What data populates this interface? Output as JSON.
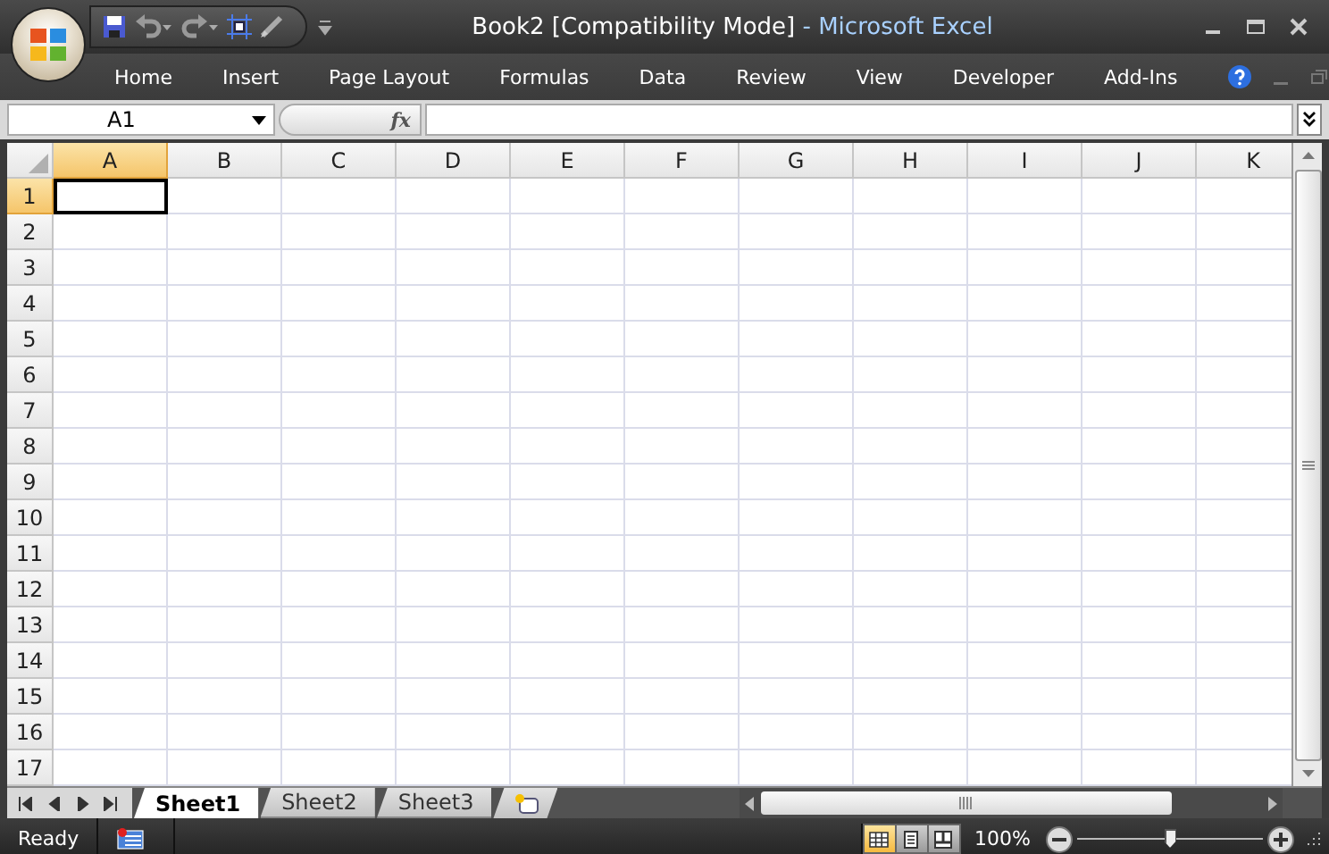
{
  "window": {
    "document_title": "Book2  [Compatibility Mode]",
    "app_title": "- Microsoft Excel"
  },
  "ribbon_tabs": [
    {
      "label": "Home"
    },
    {
      "label": "Insert"
    },
    {
      "label": "Page Layout"
    },
    {
      "label": "Formulas"
    },
    {
      "label": "Data"
    },
    {
      "label": "Review"
    },
    {
      "label": "View"
    },
    {
      "label": "Developer"
    },
    {
      "label": "Add-Ins"
    }
  ],
  "formula_bar": {
    "name_box": "A1",
    "function_button": "fx"
  },
  "columns": [
    {
      "label": "A",
      "selected": true
    },
    {
      "label": "B",
      "selected": false
    },
    {
      "label": "C",
      "selected": false
    },
    {
      "label": "D",
      "selected": false
    },
    {
      "label": "E",
      "selected": false
    },
    {
      "label": "F",
      "selected": false
    },
    {
      "label": "G",
      "selected": false
    },
    {
      "label": "H",
      "selected": false
    },
    {
      "label": "I",
      "selected": false
    },
    {
      "label": "J",
      "selected": false
    },
    {
      "label": "K",
      "selected": false
    }
  ],
  "rows": [
    {
      "label": "1",
      "selected": true
    },
    {
      "label": "2",
      "selected": false
    },
    {
      "label": "3",
      "selected": false
    },
    {
      "label": "4",
      "selected": false
    },
    {
      "label": "5",
      "selected": false
    },
    {
      "label": "6",
      "selected": false
    },
    {
      "label": "7",
      "selected": false
    },
    {
      "label": "8",
      "selected": false
    },
    {
      "label": "9",
      "selected": false
    },
    {
      "label": "10",
      "selected": false
    },
    {
      "label": "11",
      "selected": false
    },
    {
      "label": "12",
      "selected": false
    },
    {
      "label": "13",
      "selected": false
    },
    {
      "label": "14",
      "selected": false
    },
    {
      "label": "15",
      "selected": false
    },
    {
      "label": "16",
      "selected": false
    },
    {
      "label": "17",
      "selected": false
    }
  ],
  "sheets": [
    {
      "label": "Sheet1",
      "selected": true
    },
    {
      "label": "Sheet2",
      "selected": false
    },
    {
      "label": "Sheet3",
      "selected": false
    }
  ],
  "status_bar": {
    "status": "Ready",
    "view_buttons": [
      {
        "kind": "normal",
        "selected": true
      },
      {
        "kind": "page-layout",
        "selected": false
      },
      {
        "kind": "page-break",
        "selected": false
      }
    ],
    "zoom": "100%",
    "zoom_level": {
      "level": 0.5
    }
  }
}
